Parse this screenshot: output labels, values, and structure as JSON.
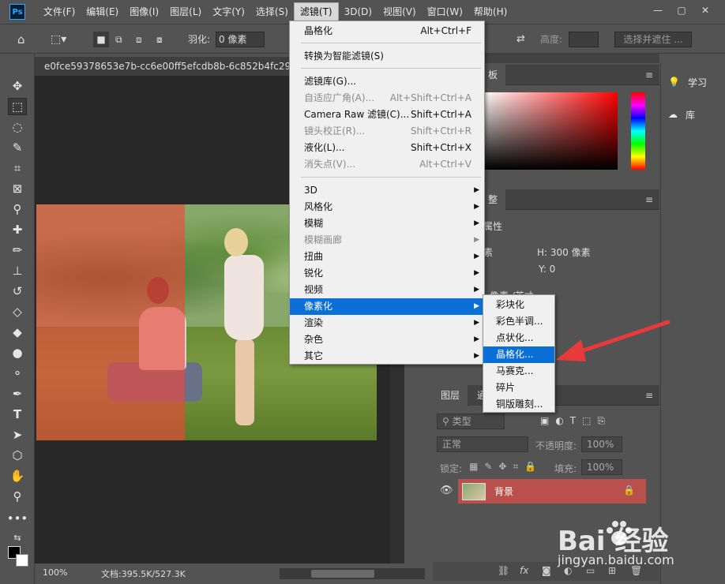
{
  "app": {
    "logo": "Ps",
    "menus": [
      "文件(F)",
      "编辑(E)",
      "图像(I)",
      "图层(L)",
      "文字(Y)",
      "选择(S)",
      "滤镜(T)",
      "3D(D)",
      "视图(V)",
      "窗口(W)",
      "帮助(H)"
    ],
    "active_menu": "滤镜(T)",
    "win": {
      "minimize": "—",
      "restore": "▢",
      "close": "✕"
    }
  },
  "options": {
    "feather_label": "羽化:",
    "feather_value": "0 像素",
    "height_label": "高度:",
    "select_mask_button": "选择并遮住 ..."
  },
  "document": {
    "tab_title": "e0fce59378653e7b-cc6e00ff5efcdb8b-6c852b4fc29f2b6",
    "zoom": "100%",
    "doc_size": "文档:395.5K/527.3K"
  },
  "filter_menu": {
    "items": [
      {
        "label": "晶格化",
        "shortcut": "Alt+Ctrl+F",
        "disabled": false
      },
      {
        "label": "转换为智能滤镜(S)",
        "shortcut": "",
        "disabled": false
      },
      {
        "label": "滤镜库(G)...",
        "shortcut": "",
        "disabled": false
      },
      {
        "label": "自适应广角(A)...",
        "shortcut": "Alt+Shift+Ctrl+A",
        "disabled": true
      },
      {
        "label": "Camera Raw 滤镜(C)...",
        "shortcut": "Shift+Ctrl+A",
        "disabled": false
      },
      {
        "label": "镜头校正(R)...",
        "shortcut": "Shift+Ctrl+R",
        "disabled": true
      },
      {
        "label": "液化(L)...",
        "shortcut": "Shift+Ctrl+X",
        "disabled": false
      },
      {
        "label": "消失点(V)...",
        "shortcut": "Alt+Ctrl+V",
        "disabled": true
      }
    ],
    "submenus": [
      {
        "label": "3D",
        "disabled": false
      },
      {
        "label": "风格化",
        "disabled": false
      },
      {
        "label": "模糊",
        "disabled": false
      },
      {
        "label": "模糊画廊",
        "disabled": true
      },
      {
        "label": "扭曲",
        "disabled": false
      },
      {
        "label": "锐化",
        "disabled": false
      },
      {
        "label": "视频",
        "disabled": false
      },
      {
        "label": "像素化",
        "disabled": false,
        "highlighted": true
      },
      {
        "label": "渲染",
        "disabled": false
      },
      {
        "label": "杂色",
        "disabled": false
      },
      {
        "label": "其它",
        "disabled": false
      }
    ]
  },
  "pixelate_submenu": {
    "items": [
      "彩块化",
      "彩色半调...",
      "点状化...",
      "晶格化...",
      "马赛克...",
      "碎片",
      "铜版雕刻..."
    ],
    "highlighted": "晶格化..."
  },
  "panels": {
    "color_tab": "板",
    "adjust_tab": "整",
    "props_title": "属性",
    "props_row1_left": "素",
    "props_h": "H:  300 像素",
    "props_y": "Y:  0",
    "props_partial": "像素 /英寸",
    "layers_tab": "图层",
    "layers_tab2": "通",
    "filter_type": "类型",
    "blend_mode": "正常",
    "opacity_label": "不透明度:",
    "opacity_value": "100%",
    "lock_label": "锁定:",
    "fill_label": "填充:",
    "fill_value": "100%",
    "layer_name": "背景"
  },
  "far_panel": {
    "learn": "学习",
    "library": "库"
  },
  "watermark": {
    "brand": "Bai  经验",
    "url": "jingyan.baidu.com"
  },
  "colors": {
    "menu_highlight": "#0a6fd6",
    "layer_selected": "#b9504c",
    "arrow": "#e83a3a"
  }
}
